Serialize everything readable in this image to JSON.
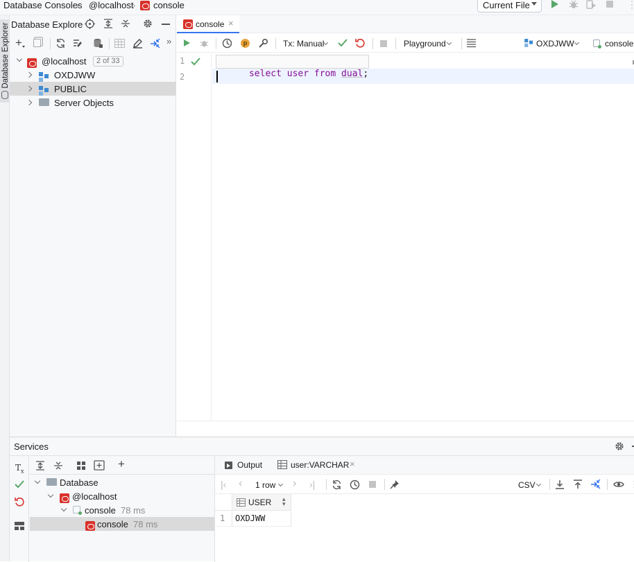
{
  "breadcrumb": {
    "item1": "Database Consoles",
    "item2": "@localhost",
    "item3": "console"
  },
  "run_config": {
    "label": "Current File"
  },
  "side_strip": {
    "label": "Database Explorer"
  },
  "explorer": {
    "title": "Database Explore",
    "root": {
      "label": "@localhost",
      "badge": "2 of 33"
    },
    "items": [
      {
        "label": "OXDJWW"
      },
      {
        "label": "PUBLIC"
      },
      {
        "label": "Server Objects"
      }
    ]
  },
  "editor_tab": {
    "label": "console"
  },
  "editor_toolbar": {
    "tx_label": "Tx: Manual",
    "playground_label": "Playground",
    "schema_label": "OXDJWW",
    "session_label": "console"
  },
  "editor": {
    "lines": [
      {
        "num": "1",
        "kw1": "select",
        "kw2": "user",
        "kw3": "from",
        "obj": "dual",
        "end": ";"
      },
      {
        "num": "2"
      }
    ]
  },
  "services": {
    "title": "Services",
    "tree": {
      "database": "Database",
      "host": "@localhost",
      "console_group": "console",
      "console_group_time": "78 ms",
      "console_item": "console",
      "console_item_time": "78 ms"
    },
    "tabs": {
      "output": "Output",
      "result": "user:VARCHAR"
    },
    "result_toolbar": {
      "rows_label": "1 row",
      "export_format": "CSV"
    },
    "grid": {
      "column": "USER",
      "rows": [
        {
          "num": "1",
          "value": "OXDJWW"
        }
      ]
    }
  },
  "colors": {
    "accent": "#3574f0",
    "run_green": "#59a869",
    "oracle_red": "#d8312b",
    "keyword": "#871094",
    "selection": "#dadada"
  }
}
